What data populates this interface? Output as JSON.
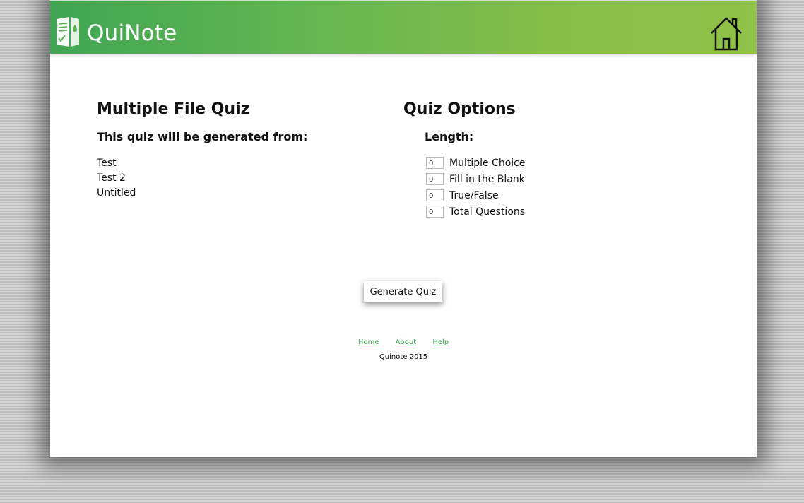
{
  "app": {
    "name": "QuiNote"
  },
  "header": {
    "logo_text": "QuiNote"
  },
  "left_panel": {
    "title": "Multiple File Quiz",
    "subtitle": "This quiz will be generated from:",
    "files": [
      "Test",
      "Test 2",
      "Untitled"
    ]
  },
  "right_panel": {
    "title": "Quiz Options",
    "length_label": "Length:",
    "options": [
      {
        "value": "0",
        "label": "Multiple Choice"
      },
      {
        "value": "0",
        "label": "Fill in the Blank"
      },
      {
        "value": "0",
        "label": "True/False"
      },
      {
        "value": "0",
        "label": "Total Questions"
      }
    ]
  },
  "actions": {
    "generate_label": "Generate Quiz"
  },
  "footer": {
    "links": [
      "Home",
      "About",
      "Help"
    ],
    "copyright": "Quinote 2015"
  },
  "colors": {
    "brand_green": "#3fa653",
    "brand_lime": "#90c148"
  },
  "icons": {
    "logo": "notebook-check-icon",
    "home": "house-icon"
  }
}
